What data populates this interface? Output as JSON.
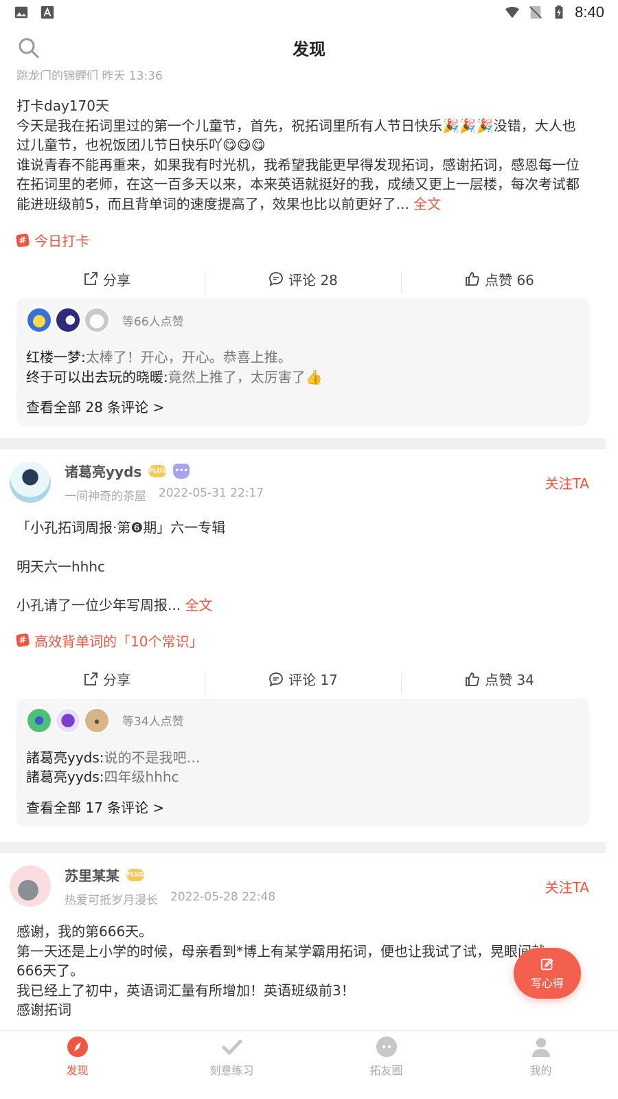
{
  "status_bar": {
    "time": "8:40"
  },
  "header": {
    "title": "发现"
  },
  "feed": {
    "partial_top_meta": "跳龙门的锦鲤们  昨天 13:36",
    "posts": [
      {
        "lines": [
          "打卡day170天",
          "今天是我在拓词里过的第一个儿童节，首先，祝拓词里所有人节日快乐🎉🎉🎉没错，大人也过儿童节，也祝饭团儿节日快乐吖😋😋😋",
          "谁说青春不能再重来，如果我有时光机，我希望我能更早得发现拓词，感谢拓词，感恩每一位在拓词里的老师，在这一百多天以来，本来英语就挺好的我，成绩又更上一层楼，每次考试都能进班级前5，而且背单词的速度提高了，效果也比以前更好了..."
        ],
        "more": "全文",
        "topic": "今日打卡",
        "share": "分享",
        "comment": "评论 28",
        "like": "点赞 66",
        "likers_text": "等66人点赞",
        "comments": [
          {
            "who": "红楼一梦:",
            "what": "太棒了！开心，开心。恭喜上推。"
          },
          {
            "who": "终于可以出去玩的晓暖:",
            "what": "竟然上推了，太厉害了👍"
          }
        ],
        "view_all": "查看全部 28 条评论 >"
      },
      {
        "author": "诸葛亮yyds",
        "follow": "关注TA",
        "group": "一间神奇的茶屋",
        "time": "2022-05-31 22:17",
        "para1": "「小孔拓词周报·第❻期」六一专辑",
        "para2": "明天六一hhhc",
        "para3": "小孔请了一位少年写周报...",
        "more": "全文",
        "topic": "高效背单词的「10个常识」",
        "share": "分享",
        "comment": "评论 17",
        "like": "点赞 34",
        "likers_text": "等34人点赞",
        "comments": [
          {
            "who": "諸葛亮yyds:",
            "what": "说的不是我吧…"
          },
          {
            "who": "諸葛亮yyds:",
            "what": "四年级hhhc"
          }
        ],
        "view_all": "查看全部 17 条评论 >"
      },
      {
        "author": "苏里某某",
        "follow": "关注TA",
        "group": "热爱可抵岁月漫长",
        "time": "2022-05-28 22:48",
        "lines": [
          "感谢，我的第666天。",
          "第一天还是上小学的时候，母亲看到*博上有某学霸用拓词，便也让我试了试，晃眼间就",
          "666天了。",
          "我已经上了初中，英语词汇量有所增加！英语班级前3！",
          "感谢拓词"
        ]
      }
    ]
  },
  "fab": {
    "label": "写心得"
  },
  "bottom_nav": [
    {
      "label": "发现",
      "active": true
    },
    {
      "label": "刻意练习",
      "active": false
    },
    {
      "label": "拓友圈",
      "active": false
    },
    {
      "label": "我的",
      "active": false
    }
  ],
  "colors": {
    "accent": "#f25540",
    "fab": "#f4604e",
    "separator": "#f0f0f2",
    "comment_bg": "#f6f6f7"
  }
}
